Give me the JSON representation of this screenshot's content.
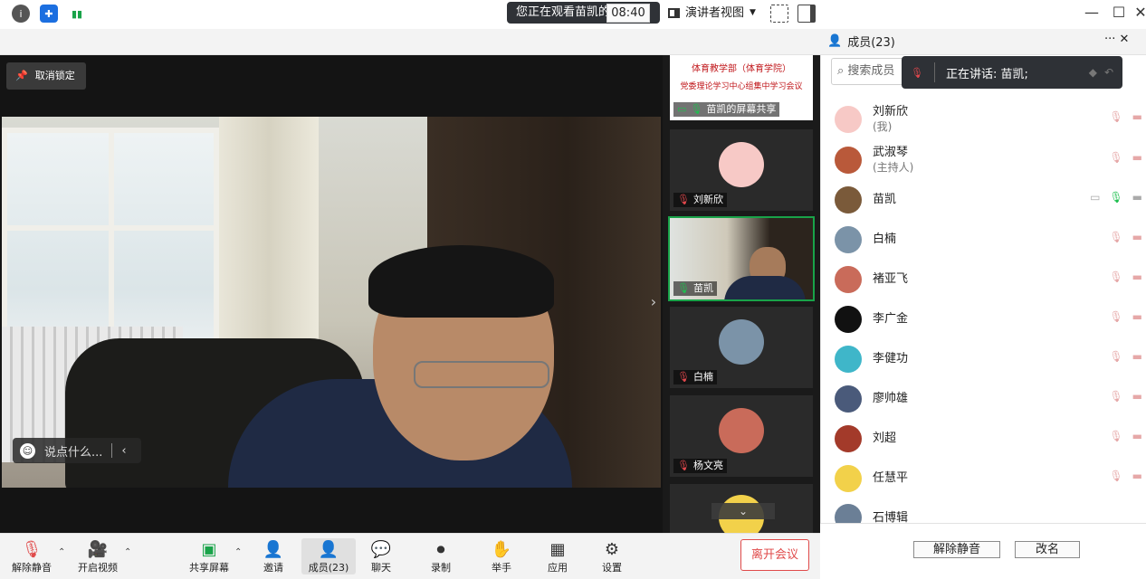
{
  "banner": {
    "text": "您正在观看苗凯的屏幕",
    "menu_icon": "list-icon"
  },
  "window": {
    "minimize": "—",
    "maximize": "☐",
    "close": "✕"
  },
  "toolbar": {
    "time": "08:40",
    "view_label": "演讲者视图",
    "info_icon": "info-icon",
    "shield_icon": "shield-icon",
    "signal_icon": "signal-icon"
  },
  "main": {
    "unlock_label": "取消锁定",
    "chat_placeholder": "说点什么..."
  },
  "strip": {
    "tiles": [
      {
        "name": "苗凯的屏幕共享",
        "doc_title": "体育教学部（体育学院）",
        "doc_sub": "党委理论学习中心组集中学习会议"
      },
      {
        "name": "刘新欣"
      },
      {
        "name": "苗凯"
      },
      {
        "name": "白楠"
      },
      {
        "name": "杨文亮"
      }
    ]
  },
  "controls": {
    "unmute": "解除静音",
    "start_video": "开启视频",
    "share_screen": "共享屏幕",
    "invite": "邀请",
    "members": "成员(23)",
    "chat": "聊天",
    "record": "录制",
    "raise_hand": "举手",
    "apps": "应用",
    "settings": "设置",
    "leave": "离开会议"
  },
  "panel": {
    "title": "成员(23)",
    "search_placeholder": "搜索成员",
    "speaking": "正在讲话: 苗凯;",
    "members": [
      {
        "name": "刘新欣",
        "sub": "(我)",
        "color": "#f7c9c6"
      },
      {
        "name": "武淑琴",
        "sub": "(主持人)",
        "color": "#b9593a"
      },
      {
        "name": "苗凯",
        "sub": "",
        "color": "#7a5a3a"
      },
      {
        "name": "白楠",
        "sub": "",
        "color": "#7b93a8"
      },
      {
        "name": "褚亚飞",
        "sub": "",
        "color": "#c96b5a"
      },
      {
        "name": "李广金",
        "sub": "",
        "color": "#111111"
      },
      {
        "name": "李健功",
        "sub": "",
        "color": "#3fb6c9"
      },
      {
        "name": "廖帅雄",
        "sub": "",
        "color": "#4a5a7a"
      },
      {
        "name": "刘超",
        "sub": "",
        "color": "#a33a2a"
      },
      {
        "name": "任慧平",
        "sub": "",
        "color": "#f2d14a"
      },
      {
        "name": "石博辑",
        "sub": "",
        "color": "#6b7f96"
      }
    ],
    "footer_unmute": "解除静音",
    "footer_rename": "改名"
  }
}
